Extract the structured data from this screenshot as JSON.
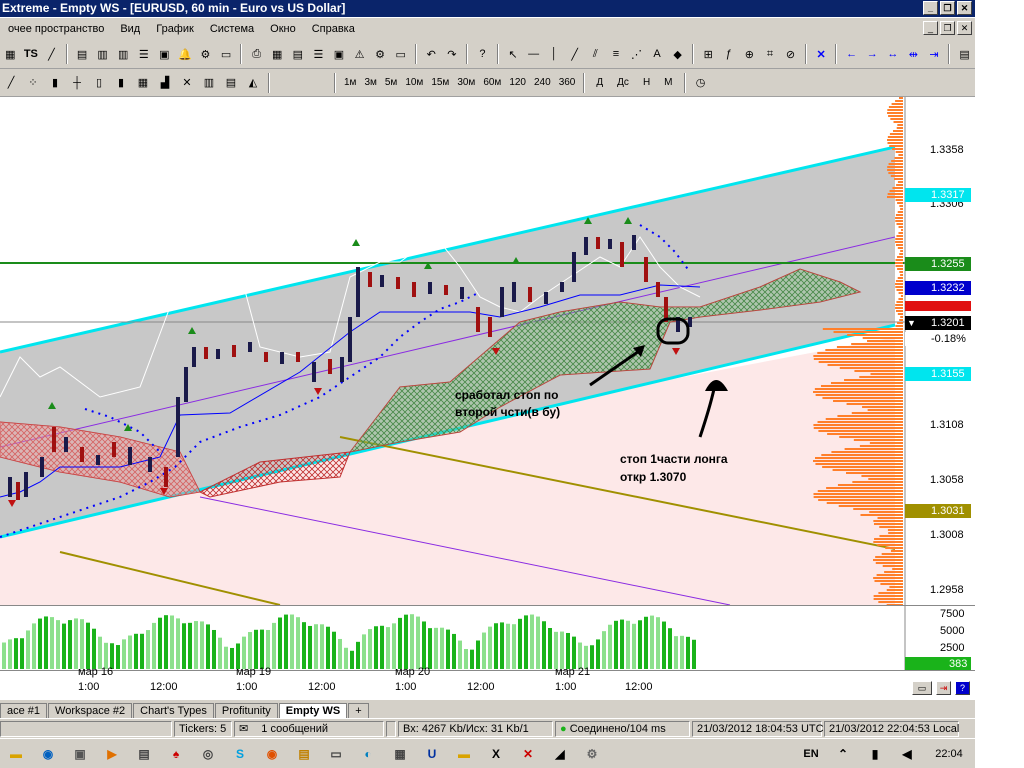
{
  "window": {
    "title": "Extreme - Empty WS - [EURUSD, 60 min - Euro vs US Dollar]"
  },
  "menu": [
    "очее пространство",
    "Вид",
    "График",
    "Система",
    "Окно",
    "Справка"
  ],
  "toolbar": {
    "timeframes": [
      "1м",
      "3м",
      "5м",
      "10м",
      "15м",
      "30м",
      "60м",
      "120",
      "240",
      "360"
    ],
    "periods": [
      "Д",
      "Дс",
      "Н",
      "М"
    ],
    "ts_label": "TS"
  },
  "chart": {
    "price_labels": [
      "1.3358",
      "1.3306",
      "1.3108",
      "1.3058",
      "1.3008",
      "1.2958"
    ],
    "tags": {
      "t1": "1.3317",
      "t2": "1.3255",
      "t3": "1.3232",
      "current": "1.3201",
      "change": "-0.18%",
      "t4": "1.3155",
      "t5": "1.3031"
    },
    "annotation1": {
      "line1": "сработал стоп по",
      "line2": "второй чсти(в бу)"
    },
    "annotation2": {
      "line1": "стоп 1части лонга",
      "line2": "откр 1.3070"
    },
    "colors": {
      "cyan": "#00e5ee",
      "green_line": "#1a8c1a",
      "purple": "#8a2be2",
      "olive": "#a09000",
      "orange": "#ff7f2a"
    }
  },
  "volume": {
    "labels": [
      "7500",
      "5000",
      "2500"
    ],
    "current": "383"
  },
  "timeaxis": {
    "dates": [
      "мар 16",
      "мар 19",
      "мар 20",
      "мар 21"
    ],
    "times": [
      "1:00",
      "12:00",
      "1:00",
      "12:00",
      "1:00",
      "12:00",
      "1:00",
      "12:00"
    ]
  },
  "tabs": [
    "ace #1",
    "Workspace #2",
    "Chart's Types",
    "Profitunity",
    "Empty WS",
    "+"
  ],
  "status": {
    "tickers": "Tickers: 5",
    "messages": "1 сообщений",
    "traffic": "Вх: 4267 Kb/Исх: 31 Kb/1",
    "connection": "Соединено/104 ms",
    "utc": "21/03/2012 18:04:53 UTC",
    "local": "21/03/2012 22:04:53 Local"
  },
  "taskbar": {
    "lang": "EN",
    "clock": "22:04"
  }
}
